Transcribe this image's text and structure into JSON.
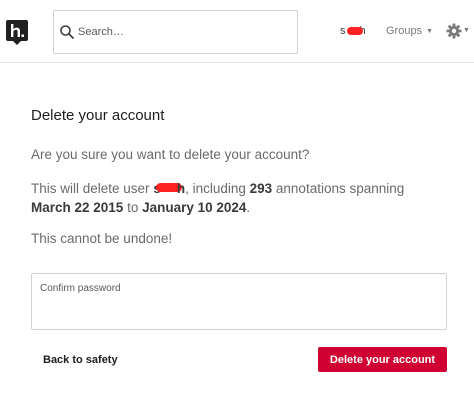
{
  "header": {
    "search": {
      "placeholder": "Search…"
    },
    "user": {
      "name_start": "s",
      "name_end": "h"
    },
    "groups_label": "Groups"
  },
  "main": {
    "title": "Delete your account",
    "question": "Are you sure you want to delete your account?",
    "details": {
      "prefix": "This will delete user ",
      "user_start": "s",
      "user_end": "h",
      "including": ", including ",
      "annotation_count": "293",
      "annotations_spanning": " annotations spanning",
      "date_from": "March 22 2015",
      "to": " to ",
      "date_to": "January 10 2024",
      "suffix": "."
    },
    "warning": "This cannot be undone!",
    "password_label": "Confirm password",
    "back_label": "Back to safety",
    "delete_label": "Delete your account"
  },
  "colors": {
    "danger": "#d00032",
    "redaction": "#ff2222"
  }
}
